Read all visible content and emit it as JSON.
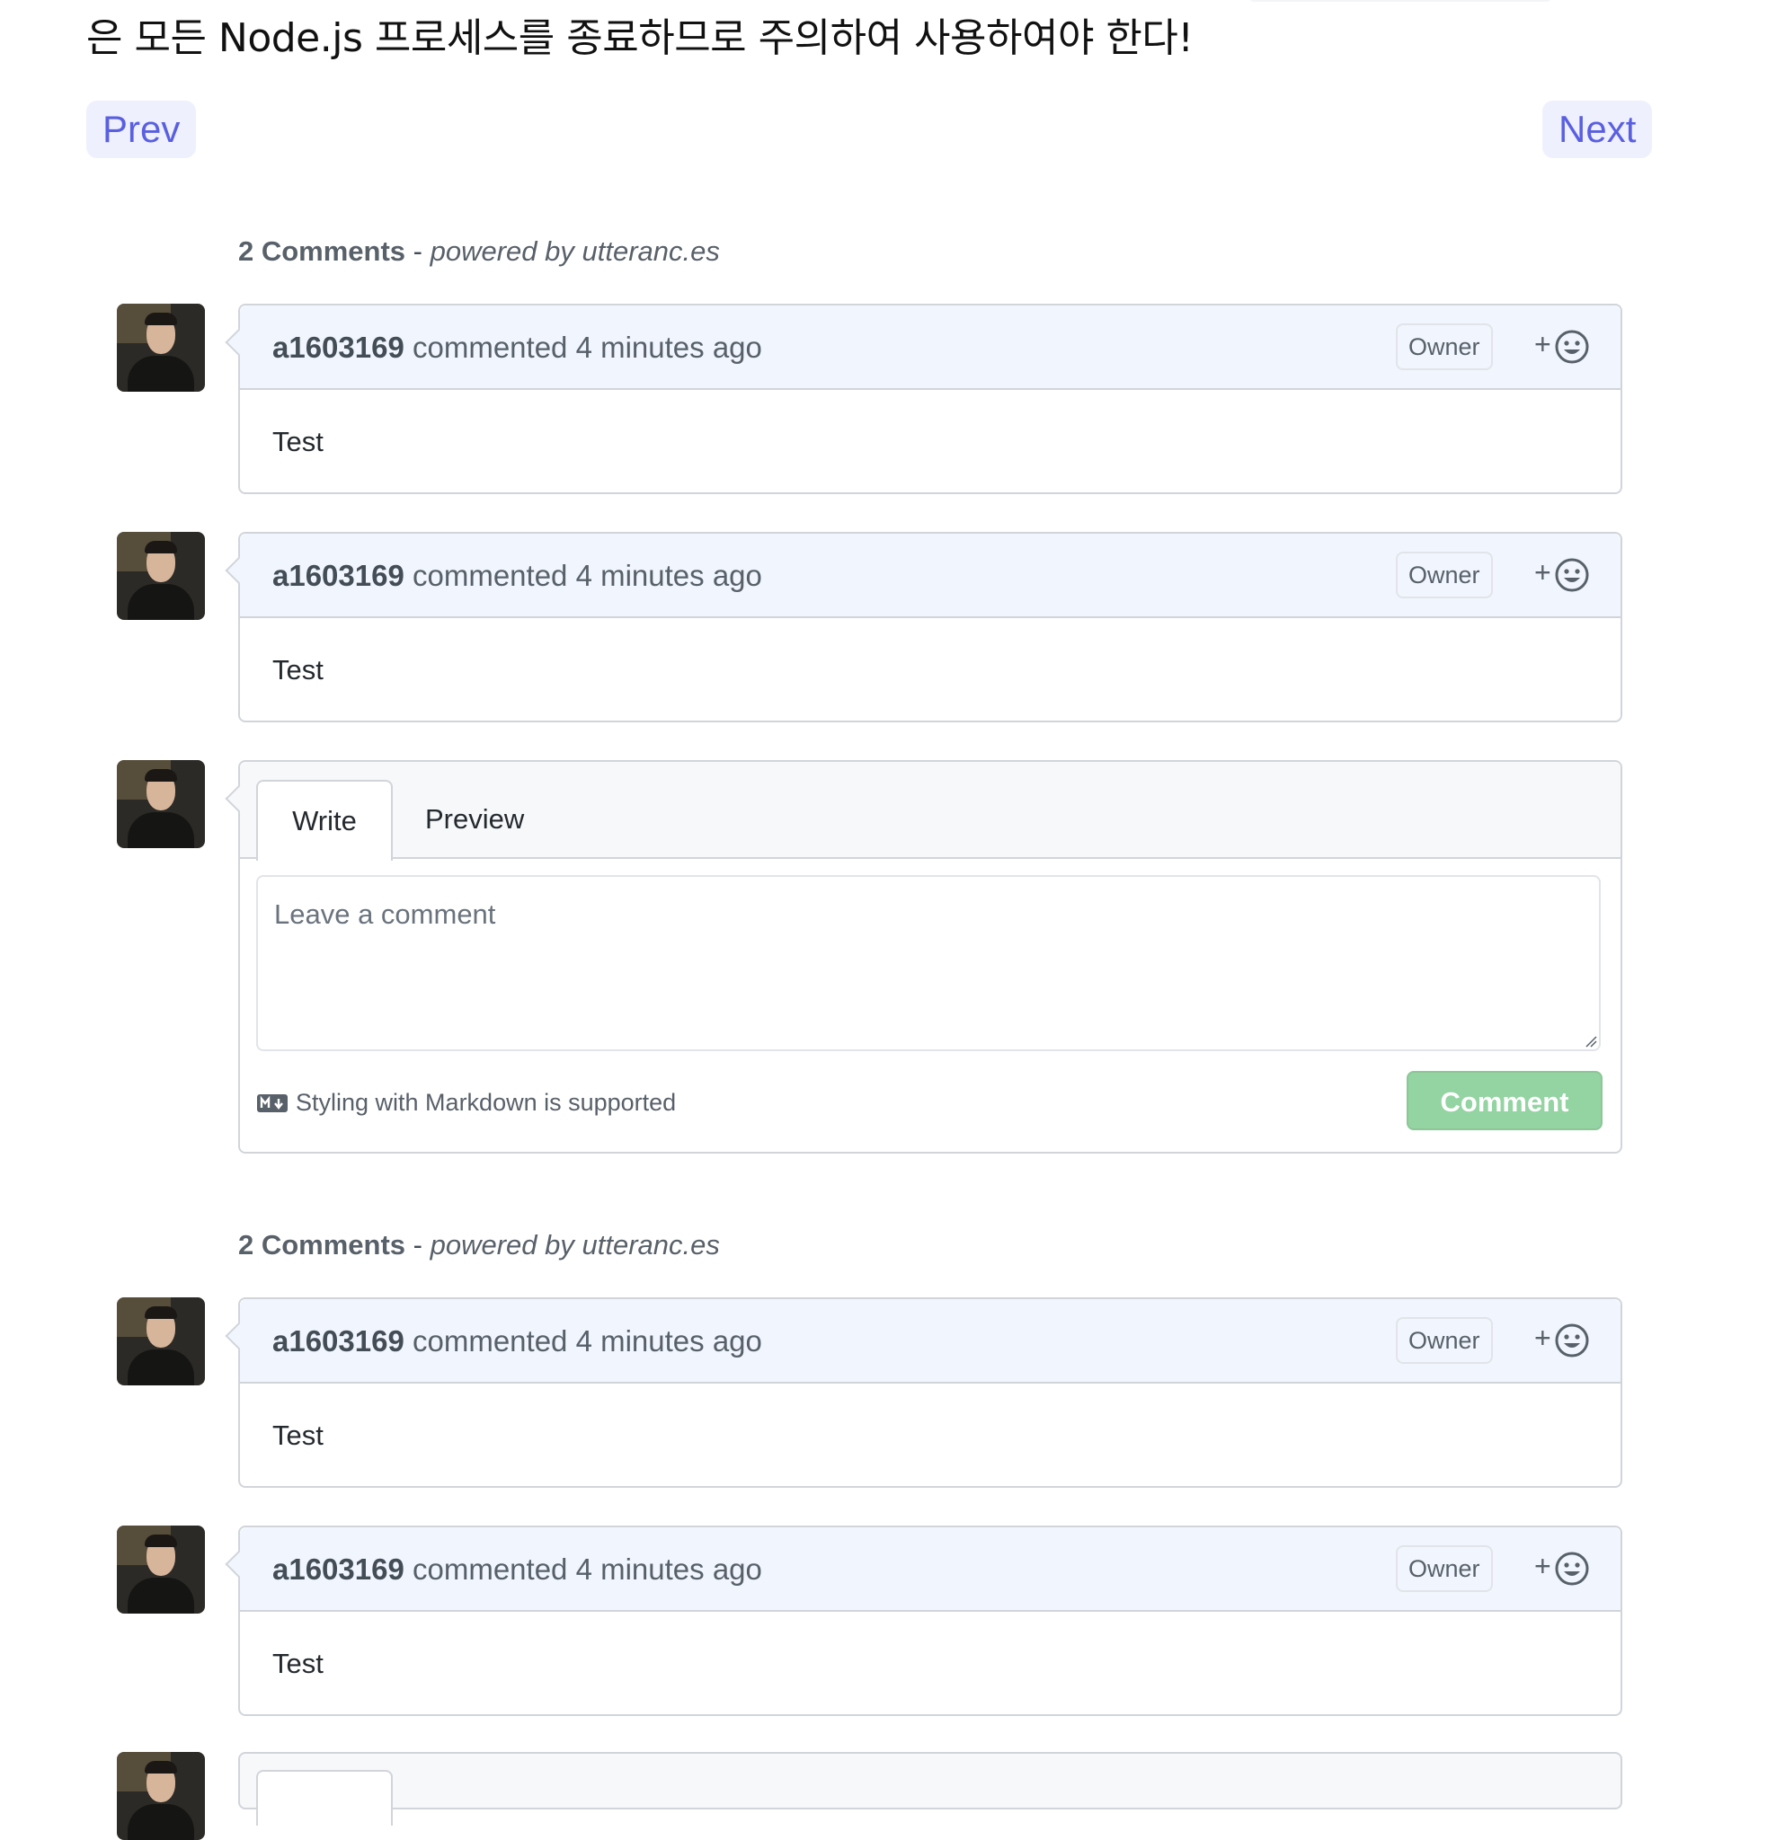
{
  "article": {
    "closing_text": "은 모든 Node.js 프로세스를 종료하므로 주의하여 사용하여야 한다!"
  },
  "pagination": {
    "prev_label": "Prev",
    "next_label": "Next"
  },
  "threads": [
    {
      "count_label": "2 Comments",
      "separator": " - ",
      "powered_by": "powered by utteranc.es",
      "comments": [
        {
          "author": "a1603169",
          "action": "commented",
          "time": "4 minutes ago",
          "badge": "Owner",
          "body": "Test"
        },
        {
          "author": "a1603169",
          "action": "commented",
          "time": "4 minutes ago",
          "badge": "Owner",
          "body": "Test"
        }
      ],
      "editor": {
        "tabs": [
          "Write",
          "Preview"
        ],
        "placeholder": "Leave a comment",
        "markdown_note": "Styling with Markdown is supported",
        "submit_label": "Comment"
      }
    },
    {
      "count_label": "2 Comments",
      "separator": " - ",
      "powered_by": "powered by utteranc.es",
      "comments": [
        {
          "author": "a1603169",
          "action": "commented",
          "time": "4 minutes ago",
          "badge": "Owner",
          "body": "Test"
        },
        {
          "author": "a1603169",
          "action": "commented",
          "time": "4 minutes ago",
          "badge": "Owner",
          "body": "Test"
        }
      ]
    }
  ],
  "reaction": {
    "plus": "+",
    "icon": "smiley-icon"
  },
  "icons": {
    "avatar": "user-avatar",
    "markdown": "markdown-icon"
  },
  "colors": {
    "accent": "#5a5fe0",
    "nav_bg": "#eef0fe",
    "comment_header_bg": "#f1f6fe",
    "submit_disabled": "#94d3a2"
  }
}
